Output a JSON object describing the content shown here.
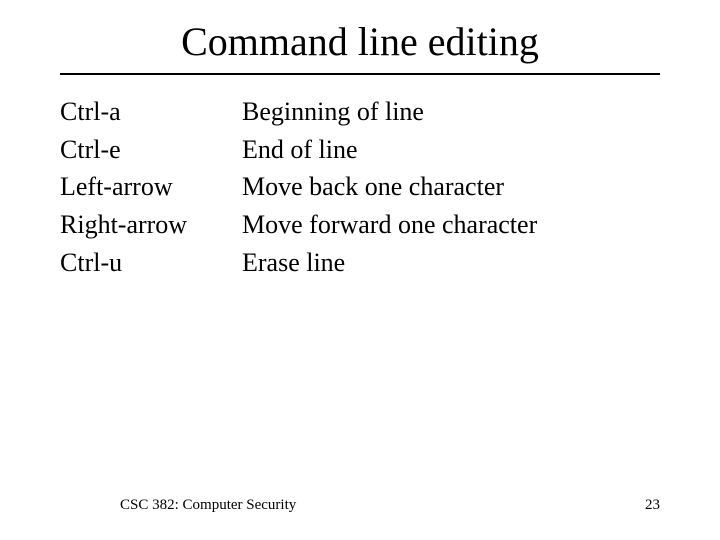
{
  "title": "Command line editing",
  "items": [
    {
      "key": "Ctrl-a",
      "desc": "Beginning of line"
    },
    {
      "key": "Ctrl-e",
      "desc": "End of line"
    },
    {
      "key": "Left-arrow",
      "desc": "Move back one character"
    },
    {
      "key": "Right-arrow",
      "desc": "Move forward one character"
    },
    {
      "key": "Ctrl-u",
      "desc": "Erase line"
    }
  ],
  "footer": {
    "course": "CSC 382: Computer Security",
    "page": "23"
  }
}
